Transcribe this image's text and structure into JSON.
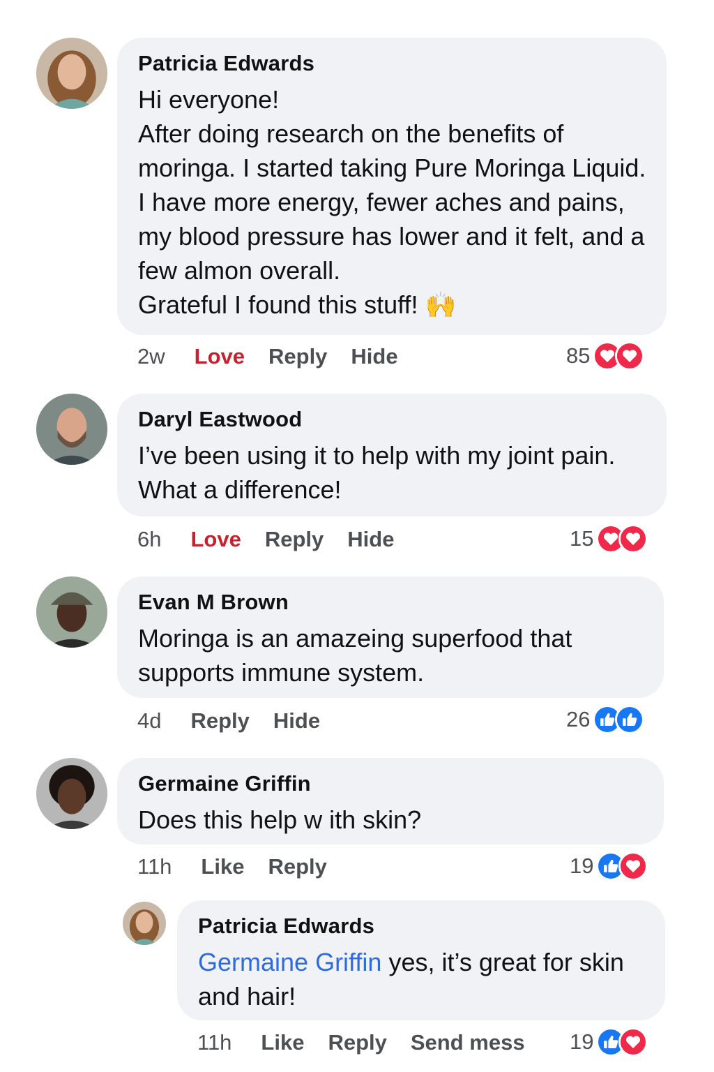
{
  "comments": [
    {
      "author": "Patricia Edwards",
      "text": "Hi everyone!\nAfter doing research on the benefits of moringa. I started taking Pure Moringa Liquid. I have more energy, fewer aches and pains, my blood pressure has lower and it felt, and a few almon overall.\nGrateful I found this stuff! 🙌",
      "time": "2w",
      "actions": [
        "Love",
        "Reply",
        "Hide"
      ],
      "reaction_count": "85",
      "reactions": [
        "love-icon",
        "love-icon"
      ]
    },
    {
      "author": "Daryl Eastwood",
      "text": "I’ve been using it to help with my joint pain. What a difference!",
      "time": "6h",
      "actions": [
        "Love",
        "Reply",
        "Hide"
      ],
      "reaction_count": "15",
      "reactions": [
        "love-icon",
        "love-icon"
      ]
    },
    {
      "author": "Evan M Brown",
      "text": "Moringa is an amazeing superfood that supports immune system.",
      "time": "4d",
      "actions": [
        "Reply",
        "Hide"
      ],
      "reaction_count": "26",
      "reactions": [
        "like-icon",
        "like-icon"
      ]
    },
    {
      "author": "Germaine Griffin",
      "text": "Does this help w ith skin?",
      "time": "11h",
      "actions": [
        "Like",
        "Reply"
      ],
      "reaction_count": "19",
      "reactions": [
        "like-icon",
        "love-icon"
      ]
    }
  ],
  "reply": {
    "author": "Patricia Edwards",
    "mention": "Germaine Griffin",
    "text": " yes, it’s great for skin and hair!",
    "time": "11h",
    "actions": [
      "Like",
      "Reply",
      "Send mess"
    ],
    "reaction_count": "19",
    "reactions": [
      "like-icon",
      "love-icon"
    ]
  },
  "colors": {
    "bubble": "#f0f2f5",
    "love_action": "#c8202e",
    "mention": "#2f6bd9",
    "like_blue": "#1877f2",
    "love_red": "#f02849"
  }
}
